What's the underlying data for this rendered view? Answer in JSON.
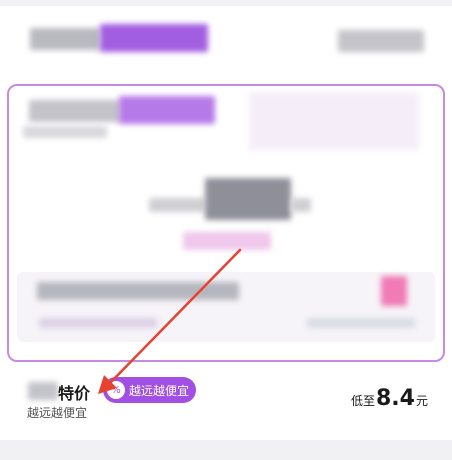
{
  "deal": {
    "title": "特价",
    "subtitle": "越远越便宜",
    "tag_label": "越远越便宜",
    "price_prefix": "低至",
    "price_value": "8.4",
    "price_unit": "元"
  },
  "colors": {
    "accent": "#a24fe4",
    "card_border": "#c58ae6",
    "arrow": "#e8412f"
  },
  "icons": {
    "tag": "percent-badge-icon"
  }
}
